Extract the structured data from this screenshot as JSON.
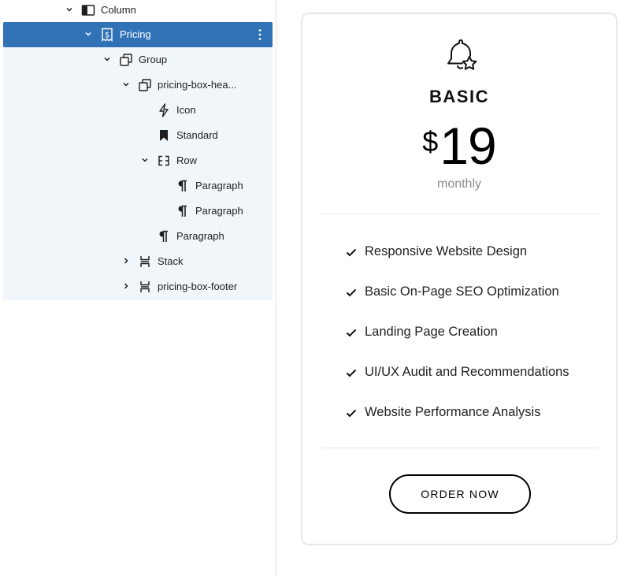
{
  "list_view": {
    "rows": [
      {
        "label": "Column",
        "icon": "column-icon",
        "expanded": true
      },
      {
        "label": "Pricing",
        "icon": "pricing-icon",
        "expanded": true,
        "selected": true
      },
      {
        "label": "Group",
        "icon": "group-icon",
        "expanded": true
      },
      {
        "label": "pricing-box-hea...",
        "icon": "group-icon",
        "expanded": true
      },
      {
        "label": "Icon",
        "icon": "lightning-icon"
      },
      {
        "label": "Standard",
        "icon": "bookmark-icon"
      },
      {
        "label": "Row",
        "icon": "row-icon",
        "expanded": true
      },
      {
        "label": "Paragraph",
        "icon": "paragraph-icon"
      },
      {
        "label": "Paragraph",
        "icon": "paragraph-icon"
      },
      {
        "label": "Paragraph",
        "icon": "paragraph-icon"
      },
      {
        "label": "Stack",
        "icon": "stack-icon",
        "expanded": false
      },
      {
        "label": "pricing-box-footer",
        "icon": "stack-icon",
        "expanded": false
      }
    ],
    "selected_color": "#3172b6"
  },
  "card": {
    "icon": "bell-star-icon",
    "plan_name": "BASIC",
    "currency": "$",
    "price": "19",
    "period": "monthly",
    "features": [
      "Responsive Website Design",
      "Basic On-Page SEO Optimization",
      "Landing Page Creation",
      "UI/UX Audit and Recommendations",
      "Website Performance Analysis"
    ],
    "button_label": "ORDER NOW"
  }
}
